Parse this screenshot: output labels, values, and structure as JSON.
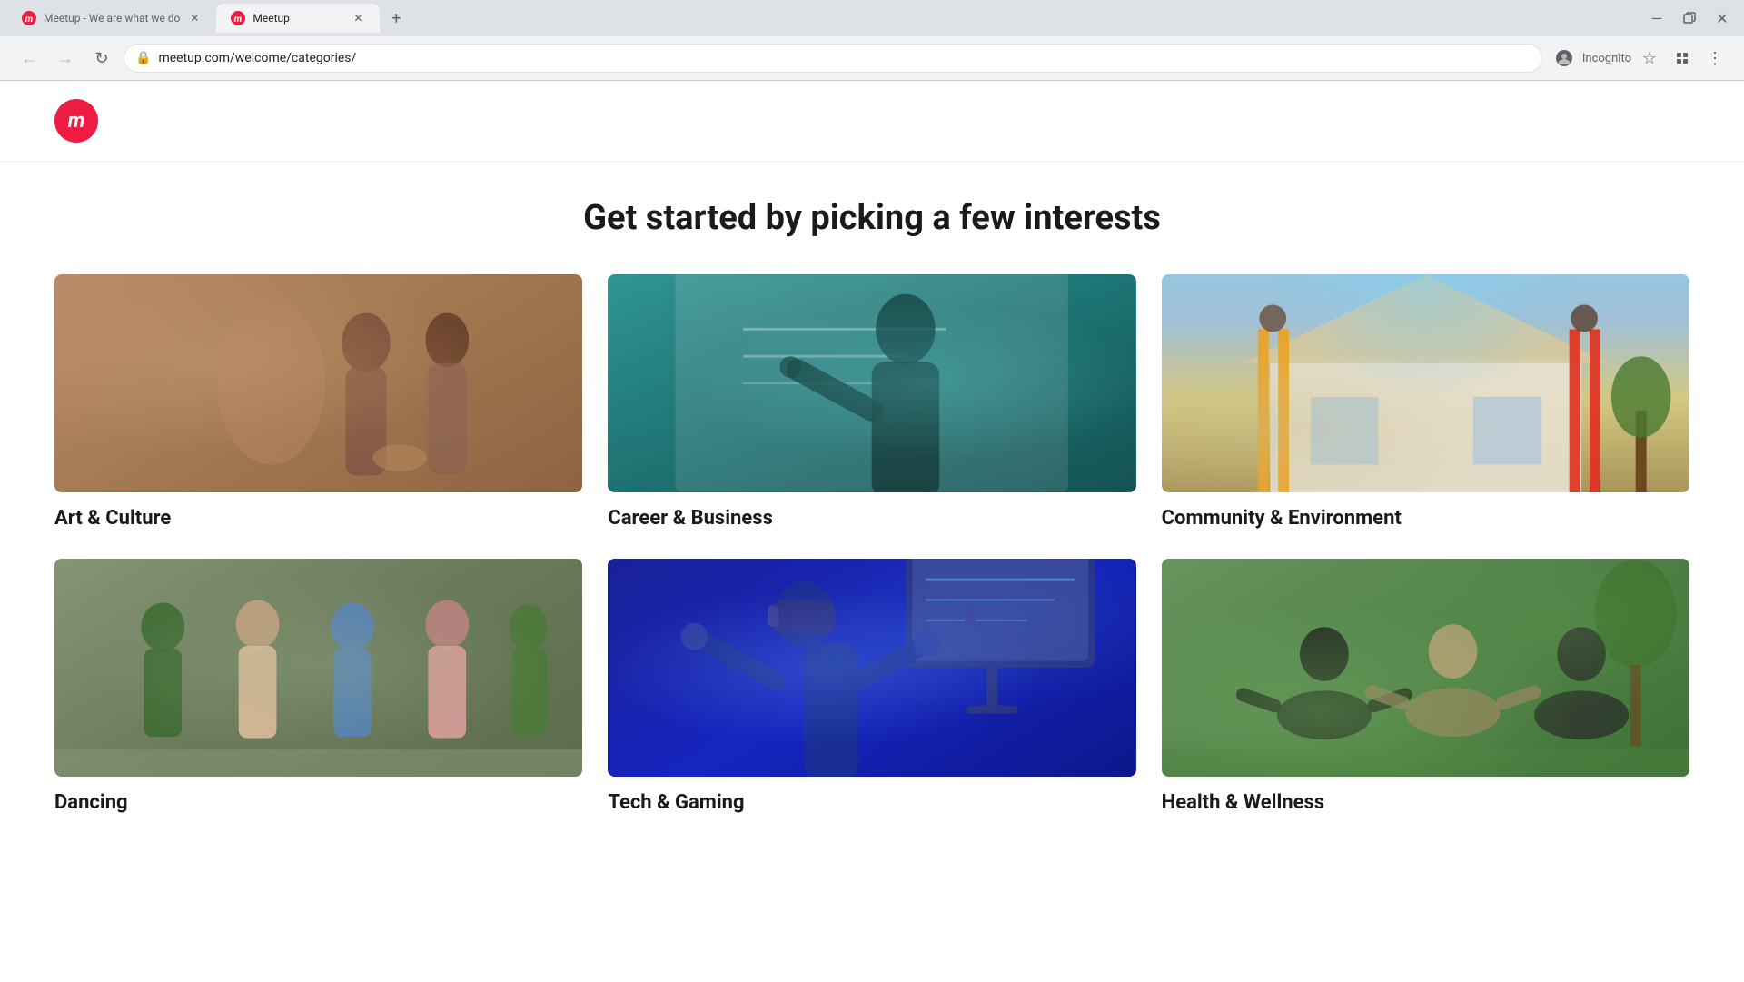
{
  "browser": {
    "tabs": [
      {
        "id": "tab1",
        "title": "Meetup - We are what we do",
        "favicon": "M",
        "active": false
      },
      {
        "id": "tab2",
        "title": "Meetup",
        "favicon": "M",
        "active": true
      }
    ],
    "new_tab_label": "+",
    "window_controls": {
      "minimize": "—",
      "restore": "❐",
      "close": "✕"
    },
    "nav": {
      "back": "←",
      "forward": "→",
      "refresh": "↻",
      "url": "meetup.com/welcome/categories/",
      "lock_icon": "🔒",
      "bookmark_icon": "☆",
      "menu_icon": "⋮",
      "profile_label": "Incognito"
    }
  },
  "page": {
    "heading": "Get started by picking a few interests",
    "logo_letter": "m",
    "categories": [
      {
        "id": "art-culture",
        "label": "Art & Culture",
        "image_class": "img-art"
      },
      {
        "id": "career-business",
        "label": "Career & Business",
        "image_class": "img-career"
      },
      {
        "id": "community-environment",
        "label": "Community & Environment",
        "image_class": "img-community"
      },
      {
        "id": "dancing",
        "label": "Dancing",
        "image_class": "img-dancing"
      },
      {
        "id": "tech-gaming",
        "label": "Tech & Gaming",
        "image_class": "img-tech"
      },
      {
        "id": "health-wellness",
        "label": "Health & Wellness",
        "image_class": "img-wellness"
      }
    ]
  }
}
